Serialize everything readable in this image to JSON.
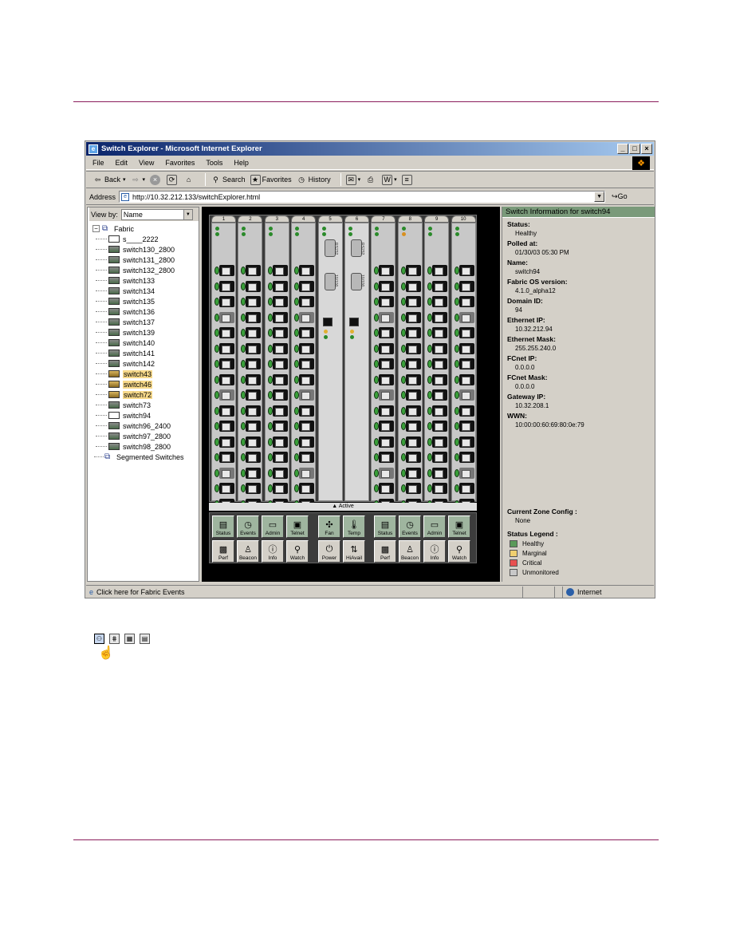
{
  "browser": {
    "title": "Switch Explorer - Microsoft Internet Explorer",
    "menus": [
      "File",
      "Edit",
      "View",
      "Favorites",
      "Tools",
      "Help"
    ],
    "toolbar": {
      "back": "Back",
      "search": "Search",
      "favorites": "Favorites",
      "history": "History"
    },
    "address_label": "Address",
    "url": "http://10.32.212.133/switchExplorer.html",
    "go_label": "Go",
    "status_text": "Click here for Fabric Events",
    "zone": "Internet"
  },
  "tree": {
    "viewby_label": "View by:",
    "viewby_value": "Name",
    "root": "Fabric",
    "items": [
      {
        "label": "s____2222",
        "status": "single"
      },
      {
        "label": "switch130_2800",
        "status": "healthy"
      },
      {
        "label": "switch131_2800",
        "status": "healthy"
      },
      {
        "label": "switch132_2800",
        "status": "healthy"
      },
      {
        "label": "switch133",
        "status": "healthy"
      },
      {
        "label": "switch134",
        "status": "healthy"
      },
      {
        "label": "switch135",
        "status": "healthy"
      },
      {
        "label": "switch136",
        "status": "healthy"
      },
      {
        "label": "switch137",
        "status": "healthy"
      },
      {
        "label": "switch139",
        "status": "healthy"
      },
      {
        "label": "switch140",
        "status": "healthy"
      },
      {
        "label": "switch141",
        "status": "healthy"
      },
      {
        "label": "switch142",
        "status": "healthy"
      },
      {
        "label": "switch43",
        "status": "marginal"
      },
      {
        "label": "switch46",
        "status": "marginal"
      },
      {
        "label": "switch72",
        "status": "marginal"
      },
      {
        "label": "switch73",
        "status": "healthy"
      },
      {
        "label": "switch94",
        "status": "single"
      },
      {
        "label": "switch96_2400",
        "status": "healthy"
      },
      {
        "label": "switch97_2800",
        "status": "healthy"
      },
      {
        "label": "switch98_2800",
        "status": "healthy"
      }
    ],
    "segmented": "Segmented Switches"
  },
  "chassis": {
    "slots": [
      "1",
      "2",
      "3",
      "4",
      "5",
      "6",
      "7",
      "8",
      "9",
      "10"
    ],
    "cp_labels": [
      "RS232",
      "10/100"
    ],
    "active_label": "Active",
    "buttons_left": [
      "Status",
      "Events",
      "Admin",
      "Telnet",
      "Perf",
      "Beacon",
      "Info",
      "Watch"
    ],
    "buttons_mid": [
      "Fan",
      "Temp",
      "Power",
      "HiAvail"
    ],
    "buttons_right": [
      "Status",
      "Events",
      "Admin",
      "Telnet",
      "Perf",
      "Beacon",
      "Info",
      "Watch"
    ]
  },
  "info": {
    "header": "Switch Information for switch94",
    "fields": [
      {
        "label": "Status:",
        "value": "Healthy"
      },
      {
        "label": "Polled at:",
        "value": "01/30/03 05:30 PM"
      },
      {
        "label": "Name:",
        "value": "switch94"
      },
      {
        "label": "Fabric OS version:",
        "value": "4.1.0_alpha12"
      },
      {
        "label": "Domain ID:",
        "value": "94"
      },
      {
        "label": "Ethernet IP:",
        "value": "10.32.212.94"
      },
      {
        "label": "Ethernet Mask:",
        "value": "255.255.240.0"
      },
      {
        "label": "FCnet IP:",
        "value": "0.0.0.0"
      },
      {
        "label": "FCnet Mask:",
        "value": "0.0.0.0"
      },
      {
        "label": "Gateway IP:",
        "value": "10.32.208.1"
      },
      {
        "label": "WWN:",
        "value": "10:00:00:60:69:80:0e:79"
      }
    ],
    "zone_label": "Current Zone Config :",
    "zone_value": "None",
    "legend_label": "Status Legend :",
    "legend": [
      {
        "label": "Healthy",
        "color": "#5a9a5a"
      },
      {
        "label": "Marginal",
        "color": "#f0d070"
      },
      {
        "label": "Critical",
        "color": "#e85050"
      },
      {
        "label": "Unmonitored",
        "color": "#c8c8c8"
      }
    ]
  }
}
